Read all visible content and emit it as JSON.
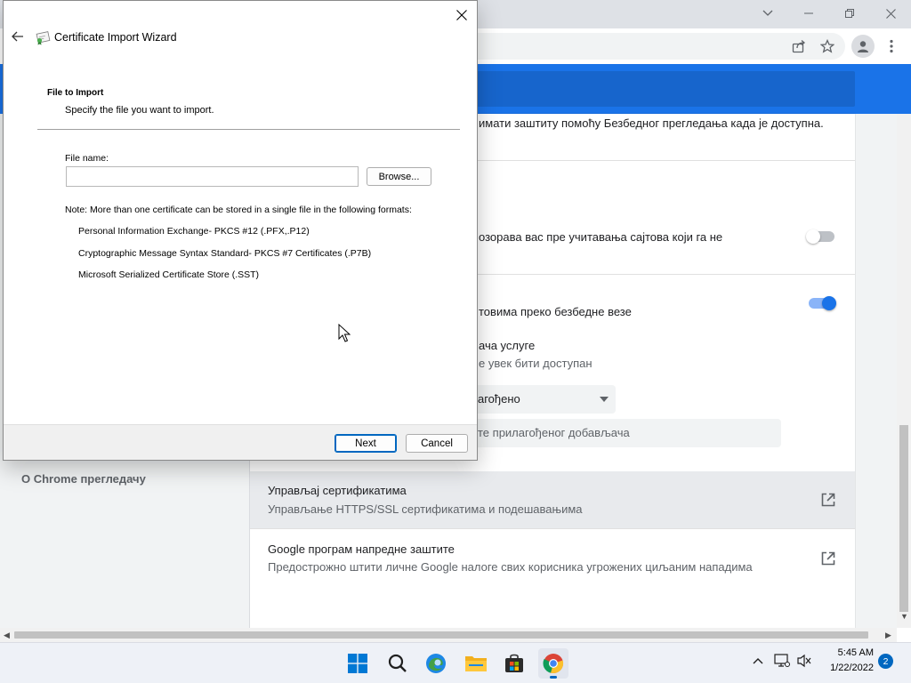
{
  "dialog": {
    "title": "Certificate Import Wizard",
    "heading": "File to Import",
    "subheading": "Specify the file you want to import.",
    "file_name_label": "File name:",
    "file_name_value": "",
    "browse_label": "Browse...",
    "note": "Note:  More than one certificate can be stored in a single file in the following formats:",
    "formats": [
      "Personal Information Exchange- PKCS #12 (.PFX,.P12)",
      "Cryptographic Message Syntax Standard- PKCS #7 Certificates (.P7B)",
      "Microsoft Serialized Certificate Store (.SST)"
    ],
    "next_label": "Next",
    "cancel_label": "Cancel"
  },
  "chrome": {
    "lines": {
      "safe_browsing_fragment": "имати заштиту помоћу Безбедног прегледања када је доступна.",
      "warn_fragment": "озорава вас пре учитавања сајтова који га не",
      "https_fragment": "товима преко безбедне везе",
      "provider_fragment": "ача услуге",
      "available_fragment": "е увек бити доступан",
      "select_value": "агођено",
      "custom_input_placeholder": "те прилагођеног добављача"
    },
    "toggles": {
      "warn_on": false,
      "https_on": true
    },
    "sidebar_about": "О Chrome прегледачу",
    "manage_certs_title": "Управљај сертификатима",
    "manage_certs_sub": "Управљање HTTPS/SSL сертификатима и подешавањима",
    "advanced_protection_title": "Google програм напредне заштите",
    "advanced_protection_sub": "Предострожно штити личне Google налоге свих корисника угрожених циљаним нападима"
  },
  "taskbar": {
    "time": "5:45 AM",
    "date": "1/22/2022",
    "notification_count": "2"
  },
  "colors": {
    "chrome_blue": "#1a73e8",
    "win_accent": "#0067c0"
  }
}
